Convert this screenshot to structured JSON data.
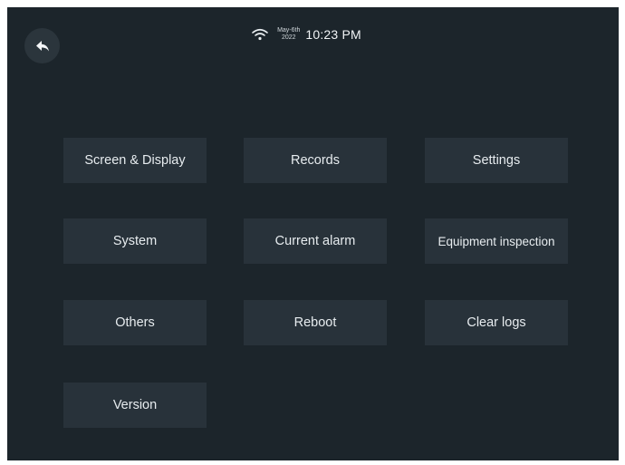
{
  "status": {
    "date_top": "May-6th",
    "date_bottom": "2022",
    "time": "10:23 PM",
    "wifi_icon": "wifi-icon"
  },
  "nav": {
    "back_icon": "back-arrow-icon"
  },
  "menu": {
    "screen_display": "Screen & Display",
    "records": "Records",
    "settings": "Settings",
    "system": "System",
    "current_alarm": "Current alarm",
    "equipment_inspection": "Equipment inspection",
    "others": "Others",
    "reboot": "Reboot",
    "clear_logs": "Clear logs",
    "version": "Version"
  },
  "colors": {
    "background": "#1c252b",
    "tile": "#28323a",
    "text": "#e7ecef"
  }
}
